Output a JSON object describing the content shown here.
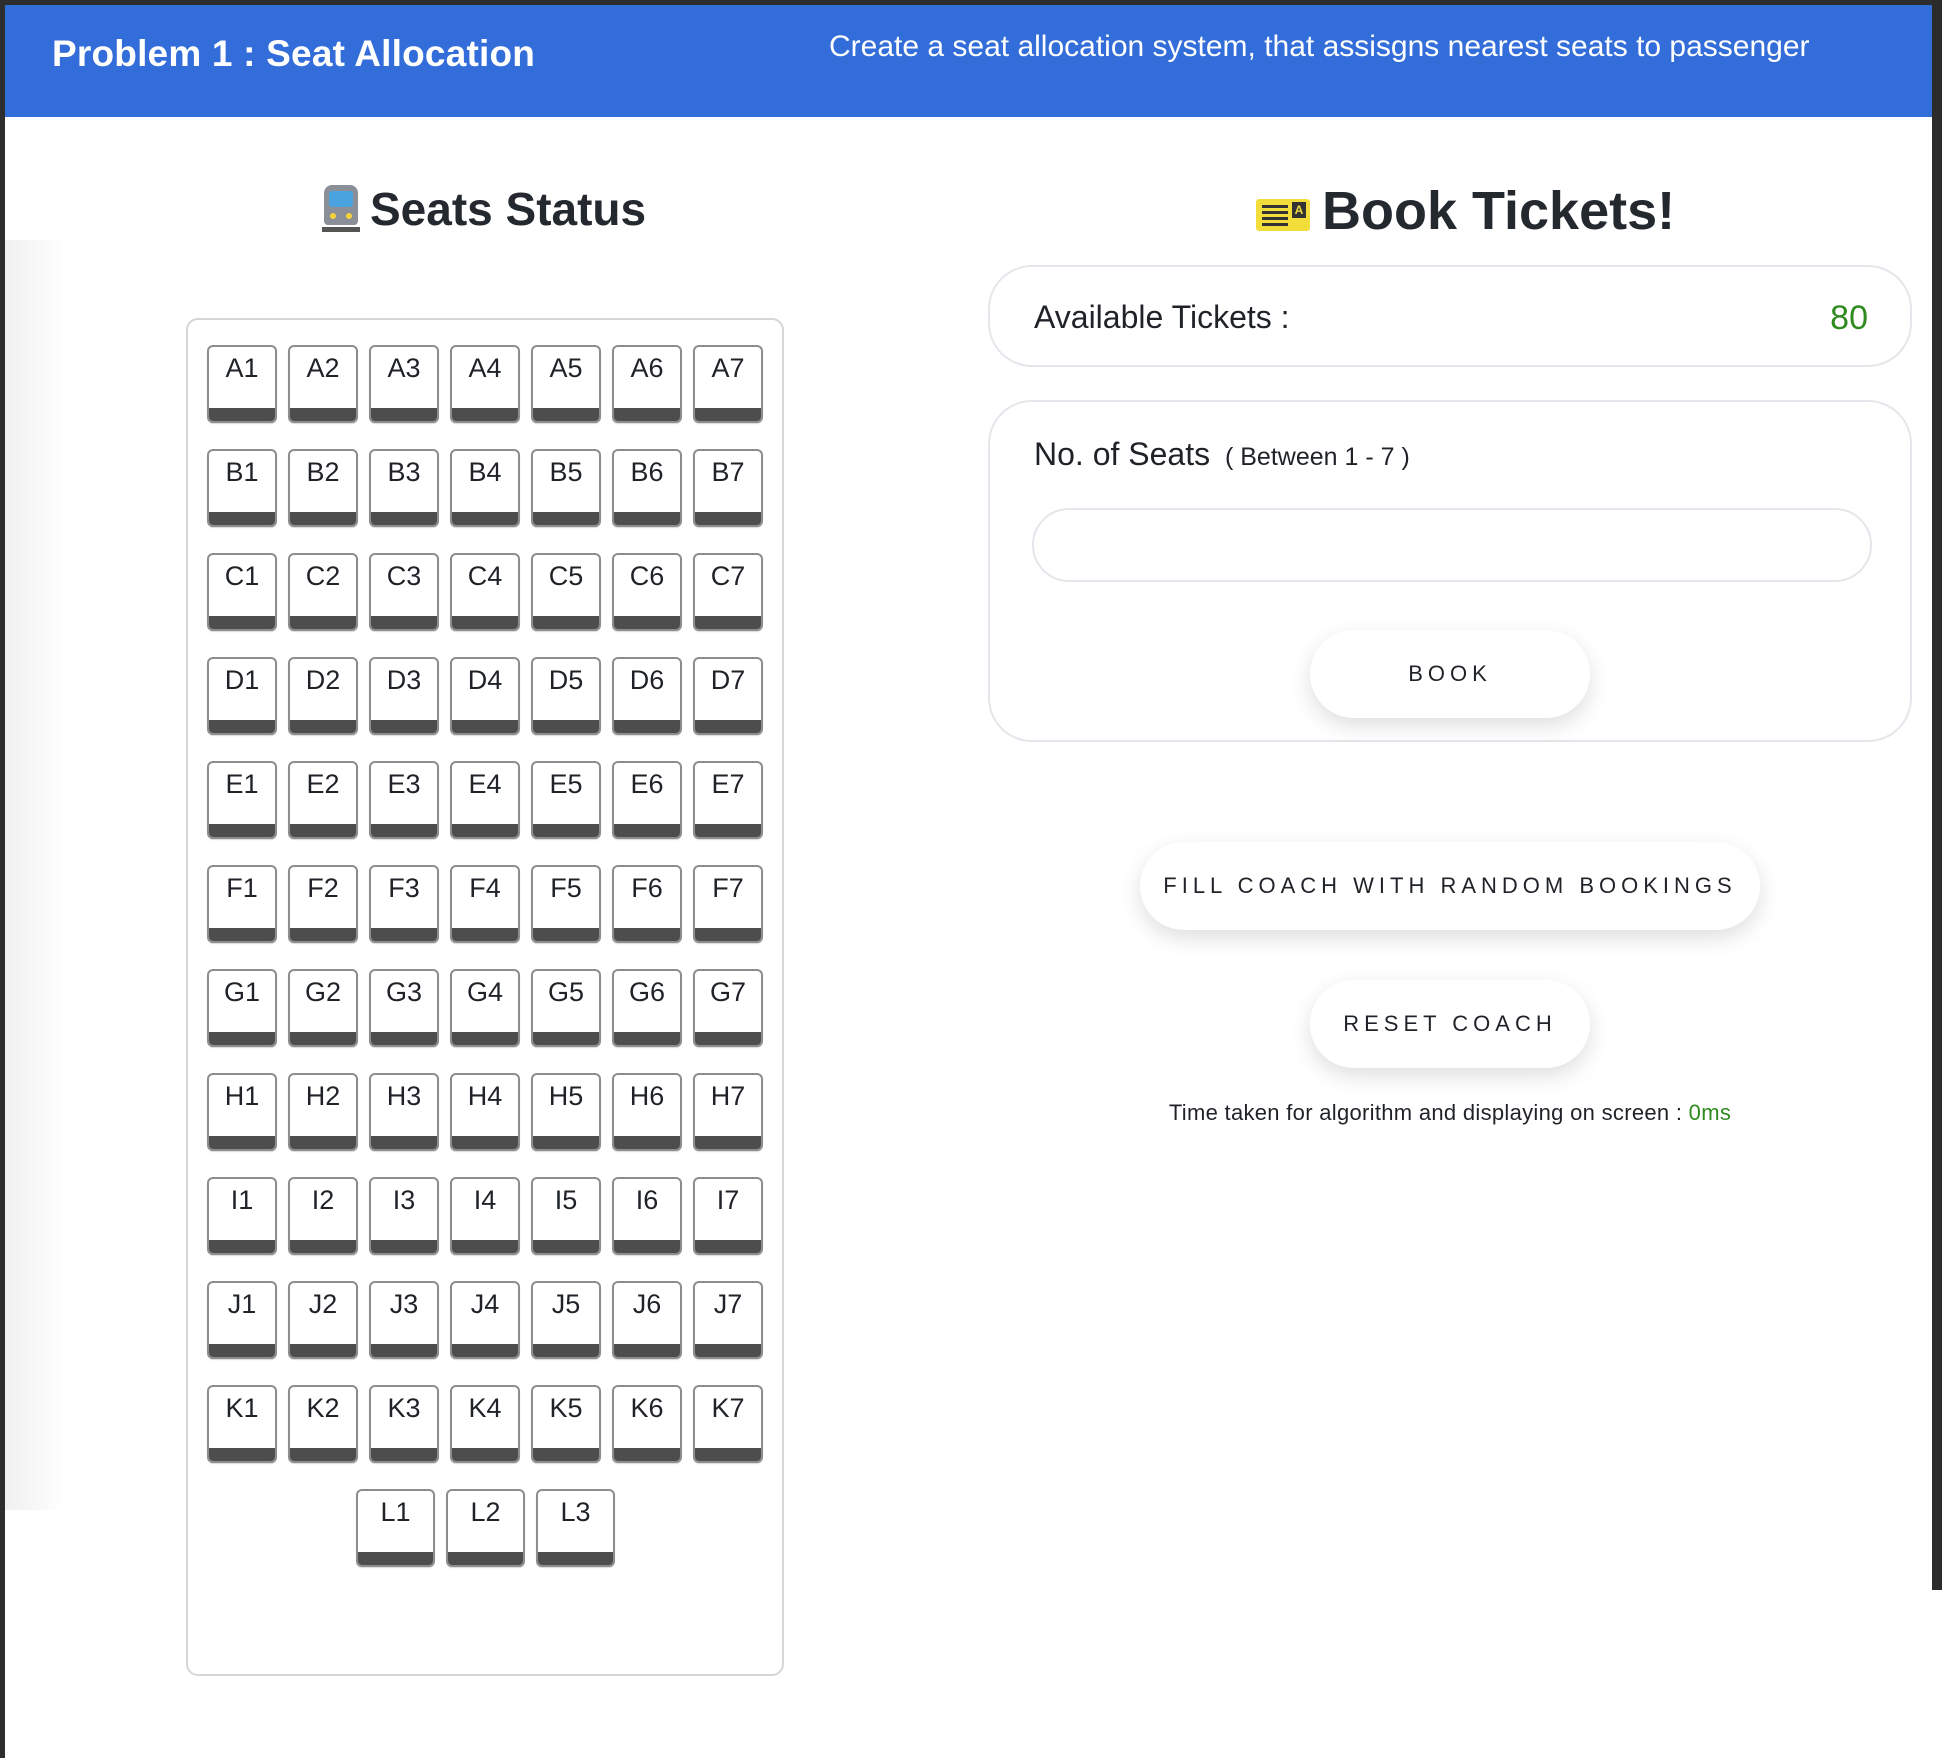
{
  "header": {
    "title": "Problem 1 : Seat Allocation",
    "subtitle": "Create a seat allocation system, that assisgns nearest seats to passenger"
  },
  "seats_panel": {
    "title": "Seats Status",
    "icon": "train-icon",
    "rows": [
      [
        "A1",
        "A2",
        "A3",
        "A4",
        "A5",
        "A6",
        "A7"
      ],
      [
        "B1",
        "B2",
        "B3",
        "B4",
        "B5",
        "B6",
        "B7"
      ],
      [
        "C1",
        "C2",
        "C3",
        "C4",
        "C5",
        "C6",
        "C7"
      ],
      [
        "D1",
        "D2",
        "D3",
        "D4",
        "D5",
        "D6",
        "D7"
      ],
      [
        "E1",
        "E2",
        "E3",
        "E4",
        "E5",
        "E6",
        "E7"
      ],
      [
        "F1",
        "F2",
        "F3",
        "F4",
        "F5",
        "F6",
        "F7"
      ],
      [
        "G1",
        "G2",
        "G3",
        "G4",
        "G5",
        "G6",
        "G7"
      ],
      [
        "H1",
        "H2",
        "H3",
        "H4",
        "H5",
        "H6",
        "H7"
      ],
      [
        "I1",
        "I2",
        "I3",
        "I4",
        "I5",
        "I6",
        "I7"
      ],
      [
        "J1",
        "J2",
        "J3",
        "J4",
        "J5",
        "J6",
        "J7"
      ],
      [
        "K1",
        "K2",
        "K3",
        "K4",
        "K5",
        "K6",
        "K7"
      ],
      [
        "L1",
        "L2",
        "L3"
      ]
    ]
  },
  "booking": {
    "title": "Book Tickets!",
    "icon": "ticket-icon",
    "available_label": "Available Tickets :",
    "available_value": "80",
    "seats_label": "No. of Seats",
    "seats_hint": "( Between 1 - 7 )",
    "seats_input_value": "",
    "book_label": "BOOK",
    "fill_label": "FILL COACH WITH RANDOM BOOKINGS",
    "reset_label": "RESET COACH",
    "timing_label": "Time taken for algorithm and displaying on screen :",
    "timing_value": "0ms"
  },
  "colors": {
    "header_bg": "#336dd9",
    "accent_green": "#2f8a1f",
    "seat_base": "#4d4d4d"
  }
}
